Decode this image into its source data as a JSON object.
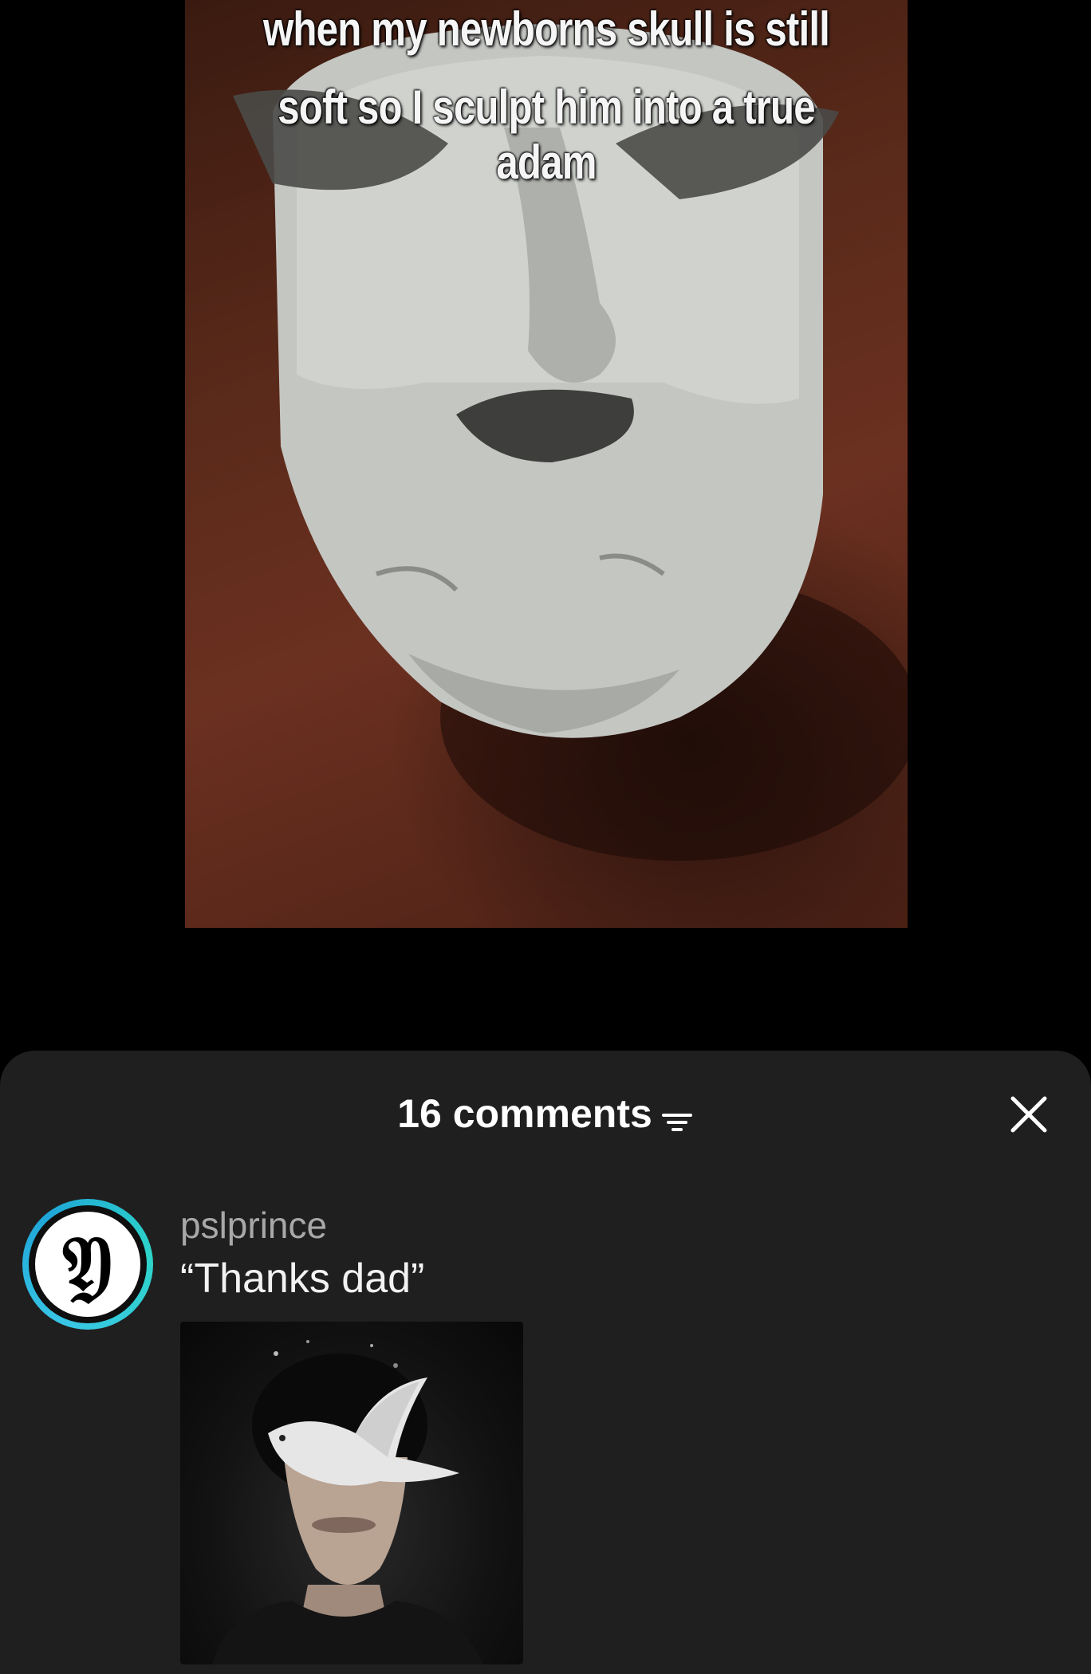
{
  "video": {
    "caption_line1": "when my newborns skull is still",
    "caption_line2": "soft so I sculpt him into a true adam"
  },
  "comments_sheet": {
    "count_label": "16 comments",
    "filter_icon": "sort-filter-icon",
    "close_icon": "close-icon",
    "background_color": "#1f1f1f"
  },
  "comments": [
    {
      "username": "pslprince",
      "text": "“Thanks dad”",
      "avatar_icon": "gothic-letter-avatar",
      "avatar_ring_color": "#2bc0e0",
      "has_image": true
    }
  ]
}
